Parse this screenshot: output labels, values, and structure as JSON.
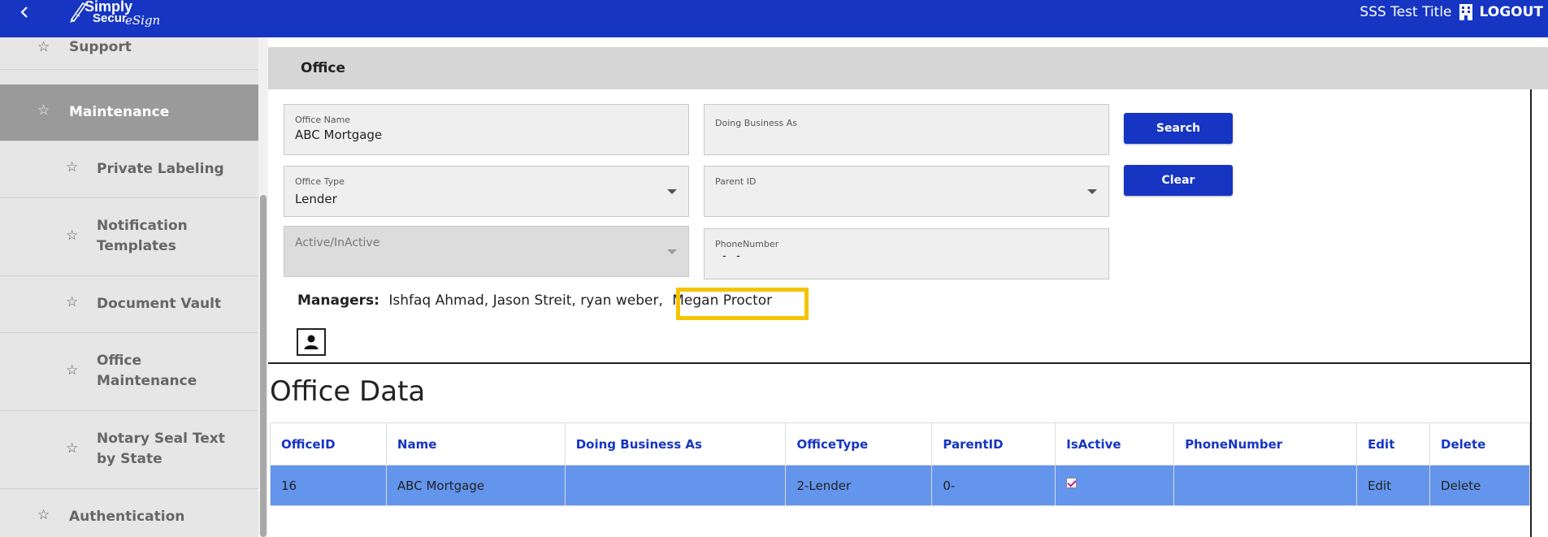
{
  "topbar": {
    "back_icon": "chevron-left-icon",
    "logo": {
      "line1": "Simply",
      "line2": "Secur",
      "script": "eSign"
    },
    "user_title": "SSS Test Title",
    "building_icon": "building-icon",
    "logout_label": "LOGOUT"
  },
  "sidebar": {
    "items": [
      {
        "label": "Support",
        "icon": "star-outline-icon",
        "level": 1,
        "active": false
      },
      {
        "label": "Maintenance",
        "icon": "star-outline-icon",
        "level": 1,
        "active": true
      },
      {
        "label": "Private Labeling",
        "icon": "star-outline-icon",
        "level": 2,
        "active": false
      },
      {
        "label": "Notification Templates",
        "line1": "Notification",
        "line2": "Templates",
        "icon": "star-outline-icon",
        "level": 2,
        "active": false
      },
      {
        "label": "Document Vault",
        "icon": "star-outline-icon",
        "level": 2,
        "active": false
      },
      {
        "label": "Office Maintenance",
        "line1": "Office",
        "line2": "Maintenance",
        "icon": "star-outline-icon",
        "level": 2,
        "active": false
      },
      {
        "label": "Notary Seal Text by State",
        "line1": "Notary Seal Text",
        "line2": "by State",
        "icon": "star-outline-icon",
        "level": 2,
        "active": false
      },
      {
        "label": "Authentication",
        "icon": "star-outline-icon",
        "level": 1,
        "active": false
      }
    ]
  },
  "page": {
    "title": "Office"
  },
  "form": {
    "office_name": {
      "label": "Office Name",
      "value": "ABC Mortgage"
    },
    "doing_business_as": {
      "label": "Doing Business As",
      "value": ""
    },
    "office_type": {
      "label": "Office Type",
      "value": "Lender"
    },
    "parent_id": {
      "label": "Parent ID",
      "value": ""
    },
    "active_inactive": {
      "label": "Active/InActive",
      "value": ""
    },
    "phone_number": {
      "label": "PhoneNumber",
      "value": "-   -"
    },
    "search_label": "Search",
    "clear_label": "Clear"
  },
  "managers": {
    "label": "Managers:",
    "names": "Ishfaq Ahmad, Jason Streit, ryan weber,",
    "highlighted_name": "Megan Proctor",
    "highlight_color": "#f5c400",
    "add_icon": "person-icon"
  },
  "office_data": {
    "title": "Office Data",
    "columns": [
      "OfficeID",
      "Name",
      "Doing Business As",
      "OfficeType",
      "ParentID",
      "IsActive",
      "PhoneNumber",
      "Edit",
      "Delete"
    ],
    "rows": [
      {
        "office_id": "16",
        "name": "ABC Mortgage",
        "doing_business_as": "",
        "office_type": "2-Lender",
        "parent_id": "0-",
        "is_active": true,
        "phone_number": "",
        "edit": "Edit",
        "delete": "Delete"
      }
    ]
  },
  "colors": {
    "brand": "#1635c2",
    "row_highlight": "#6495ed",
    "sidebar_bg": "#e6e6e6",
    "sidebar_active": "#9a9a9a",
    "header_bg": "#d6d6d6"
  }
}
